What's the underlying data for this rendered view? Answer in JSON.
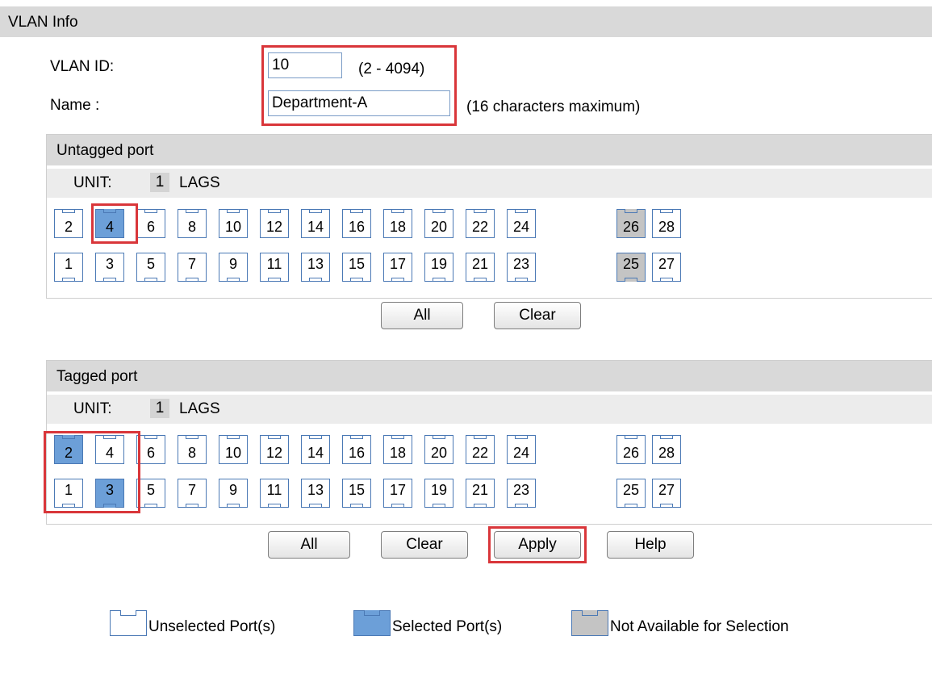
{
  "title": "VLAN Info",
  "vlan_id": {
    "label": "VLAN ID:",
    "value": "10",
    "hint": "(2 - 4094)"
  },
  "name": {
    "label": "Name :",
    "value": "Department-A",
    "hint": "(16 characters maximum)"
  },
  "untagged": {
    "header": "Untagged port",
    "unit_label": "UNIT:",
    "unit_value": "1",
    "lags_label": "LAGS",
    "top_ports": [
      "2",
      "4",
      "6",
      "8",
      "10",
      "12",
      "14",
      "16",
      "18",
      "20",
      "22",
      "24"
    ],
    "bottom_ports": [
      "1",
      "3",
      "5",
      "7",
      "9",
      "11",
      "13",
      "15",
      "17",
      "19",
      "21",
      "23"
    ],
    "extra_top": [
      "26",
      "28"
    ],
    "extra_bottom": [
      "25",
      "27"
    ],
    "selected": [
      "4"
    ],
    "not_available": [
      "25",
      "26"
    ],
    "all_label": "All",
    "clear_label": "Clear"
  },
  "tagged": {
    "header": "Tagged port",
    "unit_label": "UNIT:",
    "unit_value": "1",
    "lags_label": "LAGS",
    "top_ports": [
      "2",
      "4",
      "6",
      "8",
      "10",
      "12",
      "14",
      "16",
      "18",
      "20",
      "22",
      "24"
    ],
    "bottom_ports": [
      "1",
      "3",
      "5",
      "7",
      "9",
      "11",
      "13",
      "15",
      "17",
      "19",
      "21",
      "23"
    ],
    "extra_top": [
      "26",
      "28"
    ],
    "extra_bottom": [
      "25",
      "27"
    ],
    "selected": [
      "2",
      "3"
    ],
    "not_available": [],
    "all_label": "All",
    "clear_label": "Clear"
  },
  "apply_label": "Apply",
  "help_label": "Help",
  "legend": {
    "unselected": "Unselected Port(s)",
    "selected": "Selected Port(s)",
    "not_available": "Not Available for Selection"
  },
  "colors": {
    "selected": "#6c9fd8",
    "not_available": "#c4c4c4",
    "highlight": "#d9363a"
  }
}
